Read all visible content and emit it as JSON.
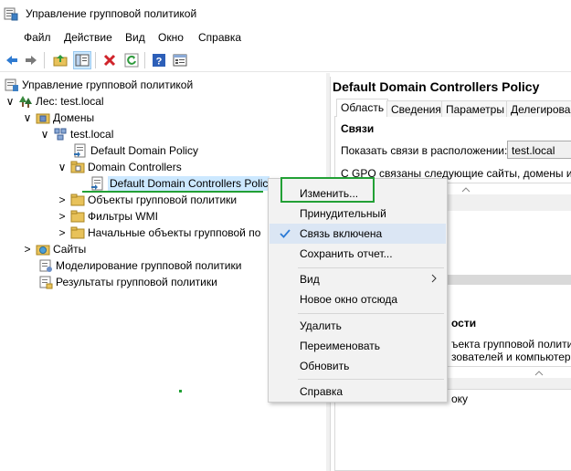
{
  "window": {
    "title": "Управление групповой политикой",
    "app_icon": "gpmc-icon"
  },
  "menu": {
    "items": [
      "Файл",
      "Действие",
      "Вид",
      "Окно",
      "Справка"
    ]
  },
  "toolbar": {
    "buttons": [
      "back-arrow-icon",
      "forward-arrow-icon",
      "up-folder-icon",
      "show-hide-tree-icon",
      "delete-icon",
      "refresh-icon",
      "help-icon",
      "properties-icon"
    ]
  },
  "tree": {
    "nodes": [
      {
        "label": "Управление групповой политикой",
        "expander": "",
        "icon": "gpmc-icon"
      },
      {
        "label": "Лес: test.local",
        "expander": "∨",
        "icon": "forest-icon"
      },
      {
        "label": "Домены",
        "expander": "∨",
        "icon": "domains-folder-icon"
      },
      {
        "label": "test.local",
        "expander": "∨",
        "icon": "domain-icon"
      },
      {
        "label": "Default Domain Policy",
        "expander": "",
        "icon": "gpo-link-icon"
      },
      {
        "label": "Domain Controllers",
        "expander": "∨",
        "icon": "ou-icon"
      },
      {
        "label": "Default Domain Controllers Polic",
        "expander": "",
        "icon": "gpo-link-icon"
      },
      {
        "label": "Объекты групповой политики",
        "expander": ">",
        "icon": "folder-icon"
      },
      {
        "label": "Фильтры WMI",
        "expander": ">",
        "icon": "folder-icon"
      },
      {
        "label": "Начальные объекты групповой по",
        "expander": ">",
        "icon": "folder-icon"
      },
      {
        "label": "Сайты",
        "expander": ">",
        "icon": "sites-icon"
      },
      {
        "label": "Моделирование групповой политики",
        "expander": "",
        "icon": "modeling-icon"
      },
      {
        "label": "Результаты групповой политики",
        "expander": "",
        "icon": "results-icon"
      }
    ]
  },
  "right_pane": {
    "title": "Default Domain Controllers Policy",
    "tabs": [
      "Область",
      "Сведения",
      "Параметры",
      "Делегирован"
    ],
    "links_heading": "Связи",
    "show_links_label": "Показать связи в расположении:",
    "location_value": "test.local",
    "linked_text": "С GPO связаны следующие сайты, домены и подр",
    "filter_heading_fragment": "ости",
    "filter_text_1": "ъекта групповой политики",
    "filter_text_2": "зователей и компьютеров",
    "wmi_fragment": "оку"
  },
  "context_menu": {
    "items": [
      {
        "label": "Изменить...",
        "checked": false,
        "submenu": false,
        "highlighted": false
      },
      {
        "label": "Принудительный",
        "checked": false,
        "submenu": false,
        "highlighted": false
      },
      {
        "label": "Связь включена",
        "checked": true,
        "submenu": false,
        "highlighted": true
      },
      {
        "label": "Сохранить отчет...",
        "checked": false,
        "submenu": false,
        "highlighted": false
      },
      {
        "label": "Вид",
        "checked": false,
        "submenu": true,
        "highlighted": false
      },
      {
        "label": "Новое окно отсюда",
        "checked": false,
        "submenu": false,
        "highlighted": false
      },
      {
        "label": "Удалить",
        "checked": false,
        "submenu": false,
        "highlighted": false
      },
      {
        "label": "Переименовать",
        "checked": false,
        "submenu": false,
        "highlighted": false
      },
      {
        "label": "Обновить",
        "checked": false,
        "submenu": false,
        "highlighted": false
      },
      {
        "label": "Справка",
        "checked": false,
        "submenu": false,
        "highlighted": false
      }
    ]
  },
  "colors": {
    "annotation_green": "#22a035",
    "highlight_blue": "#dbe6f4",
    "selection_blue": "#cce8ff"
  }
}
